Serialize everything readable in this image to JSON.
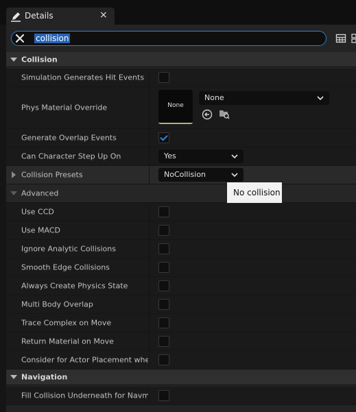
{
  "tab": {
    "title": "Details",
    "close": "×",
    "icon": "pencil-icon"
  },
  "search": {
    "value": "collision",
    "clear_icon": "close-circle-icon"
  },
  "toolbar": {
    "icons": [
      "table-icon",
      "settings-icon"
    ]
  },
  "sections": {
    "collision": "Collision",
    "advanced": "Advanced",
    "navigation": "Navigation"
  },
  "props": {
    "sim_hit": {
      "label": "Simulation Generates Hit Events",
      "checked": false
    },
    "phys_mat": {
      "label": "Phys Material Override",
      "thumb": "None",
      "value": "None"
    },
    "overlap": {
      "label": "Generate Overlap Events",
      "checked": true
    },
    "step_up": {
      "label": "Can Character Step Up On",
      "value": "Yes"
    },
    "presets": {
      "label": "Collision Presets",
      "value": "NoCollision"
    },
    "ccd": {
      "label": "Use CCD",
      "checked": false
    },
    "macd": {
      "label": "Use MACD",
      "checked": false
    },
    "ignore_analytic": {
      "label": "Ignore Analytic Collisions",
      "checked": false
    },
    "smooth_edge": {
      "label": "Smooth Edge Collisions",
      "checked": false
    },
    "always_phys": {
      "label": "Always Create Physics State",
      "checked": false
    },
    "multi_body": {
      "label": "Multi Body Overlap",
      "checked": false
    },
    "trace_complex": {
      "label": "Trace Complex on Move",
      "checked": false
    },
    "return_mat": {
      "label": "Return Material on Move",
      "checked": false
    },
    "actor_place": {
      "label": "Consider for Actor Placement when…",
      "checked": false
    },
    "fill_nav": {
      "label": "Fill Collision Underneath for Navme…",
      "checked": false
    }
  },
  "tooltip": {
    "text": "No collision"
  },
  "colors": {
    "accent": "#2a8be0",
    "search_border": "#2a7fd4",
    "selection": "#2663b3"
  }
}
